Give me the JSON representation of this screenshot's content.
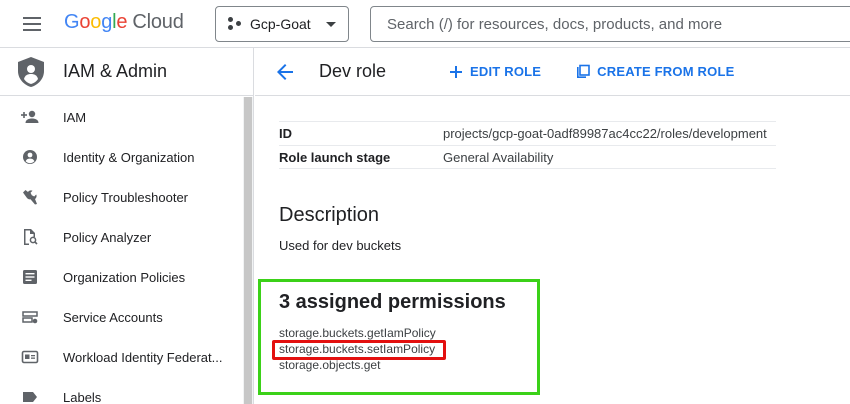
{
  "header": {
    "logo_google": "Google",
    "logo_cloud": "Cloud",
    "project_name": "Gcp-Goat",
    "search_placeholder": "Search (/) for resources, docs, products, and more"
  },
  "sidebar": {
    "title": "IAM & Admin",
    "items": [
      {
        "label": "IAM",
        "icon": "person-add-icon"
      },
      {
        "label": "Identity & Organization",
        "icon": "account-circle-icon"
      },
      {
        "label": "Policy Troubleshooter",
        "icon": "wrench-icon"
      },
      {
        "label": "Policy Analyzer",
        "icon": "document-search-icon"
      },
      {
        "label": "Organization Policies",
        "icon": "list-document-icon"
      },
      {
        "label": "Service Accounts",
        "icon": "service-account-icon"
      },
      {
        "label": "Workload Identity Federat...",
        "icon": "id-card-icon"
      },
      {
        "label": "Labels",
        "icon": "label-icon"
      }
    ]
  },
  "main": {
    "title": "Dev role",
    "edit_label": "EDIT ROLE",
    "create_label": "CREATE FROM ROLE",
    "details": [
      {
        "key": "ID",
        "value": "projects/gcp-goat-0adf89987ac4cc22/roles/development"
      },
      {
        "key": "Role launch stage",
        "value": "General Availability"
      }
    ],
    "description_heading": "Description",
    "description_text": "Used for dev buckets",
    "permissions_heading": "3 assigned permissions",
    "permissions": [
      "storage.buckets.getIamPolicy",
      "storage.buckets.setIamPolicy",
      "storage.objects.get"
    ]
  },
  "colors": {
    "accent": "#1a73e8",
    "annotation_green": "#3bd118",
    "annotation_red": "#e3100f"
  }
}
